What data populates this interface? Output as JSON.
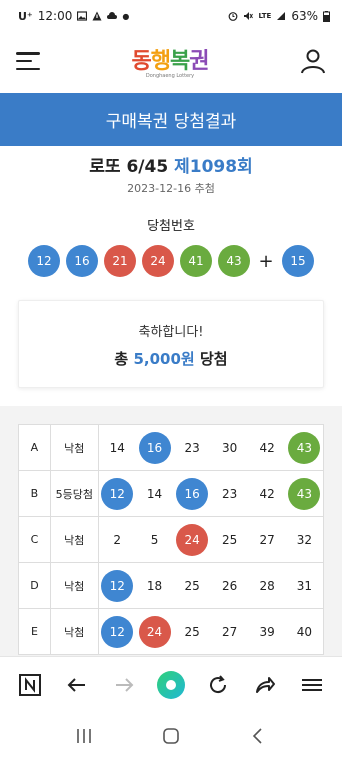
{
  "status_bar": {
    "time": "12:00",
    "carrier": "U⁺",
    "network": "LTE",
    "battery": "63%"
  },
  "app": {
    "logo_text": [
      "동",
      "행",
      "복",
      "권"
    ],
    "logo_sub": "Donghaeng Lottery"
  },
  "banner": {
    "title": "구매복권 당첨결과"
  },
  "game": {
    "name": "로또 6/45",
    "round": "제1098회",
    "draw_date": "2023-12-16 추첨",
    "winning_label": "당첨번호",
    "winning_numbers": [
      {
        "n": "12",
        "color": "blue"
      },
      {
        "n": "16",
        "color": "blue"
      },
      {
        "n": "21",
        "color": "red"
      },
      {
        "n": "24",
        "color": "red"
      },
      {
        "n": "41",
        "color": "green"
      },
      {
        "n": "43",
        "color": "green"
      }
    ],
    "plus": "+",
    "bonus": {
      "n": "15",
      "color": "blue"
    }
  },
  "result": {
    "congrats": "축하합니다!",
    "prize_prefix": "총",
    "prize_amount": "5,000원",
    "prize_suffix": "당첨"
  },
  "ticket": {
    "rows": [
      {
        "letter": "A",
        "rank": "낙첨",
        "numbers": [
          {
            "n": "14",
            "hit": false
          },
          {
            "n": "16",
            "hit": true,
            "color": "blue"
          },
          {
            "n": "23",
            "hit": false
          },
          {
            "n": "30",
            "hit": false
          },
          {
            "n": "42",
            "hit": false
          },
          {
            "n": "43",
            "hit": true,
            "color": "green"
          }
        ]
      },
      {
        "letter": "B",
        "rank": "5등당첨",
        "numbers": [
          {
            "n": "12",
            "hit": true,
            "color": "blue"
          },
          {
            "n": "14",
            "hit": false
          },
          {
            "n": "16",
            "hit": true,
            "color": "blue"
          },
          {
            "n": "23",
            "hit": false
          },
          {
            "n": "42",
            "hit": false
          },
          {
            "n": "43",
            "hit": true,
            "color": "green"
          }
        ]
      },
      {
        "letter": "C",
        "rank": "낙첨",
        "numbers": [
          {
            "n": "2",
            "hit": false
          },
          {
            "n": "5",
            "hit": false
          },
          {
            "n": "24",
            "hit": true,
            "color": "red"
          },
          {
            "n": "25",
            "hit": false
          },
          {
            "n": "27",
            "hit": false
          },
          {
            "n": "32",
            "hit": false
          }
        ]
      },
      {
        "letter": "D",
        "rank": "낙첨",
        "numbers": [
          {
            "n": "12",
            "hit": true,
            "color": "blue"
          },
          {
            "n": "18",
            "hit": false
          },
          {
            "n": "25",
            "hit": false
          },
          {
            "n": "26",
            "hit": false
          },
          {
            "n": "28",
            "hit": false
          },
          {
            "n": "31",
            "hit": false
          }
        ]
      },
      {
        "letter": "E",
        "rank": "낙첨",
        "numbers": [
          {
            "n": "12",
            "hit": true,
            "color": "blue"
          },
          {
            "n": "24",
            "hit": true,
            "color": "red"
          },
          {
            "n": "25",
            "hit": false
          },
          {
            "n": "27",
            "hit": false
          },
          {
            "n": "39",
            "hit": false
          },
          {
            "n": "40",
            "hit": false
          }
        ]
      }
    ]
  },
  "browser_toolbar": {
    "icons": [
      "naver-n-icon",
      "back-arrow-icon",
      "forward-arrow-icon",
      "home-circle-icon",
      "refresh-icon",
      "share-icon",
      "menu-icon"
    ]
  },
  "colors": {
    "accent": "#3a7cc7",
    "ball_blue": "#3f86d1",
    "ball_red": "#d9584a",
    "ball_green": "#6aab3f"
  }
}
